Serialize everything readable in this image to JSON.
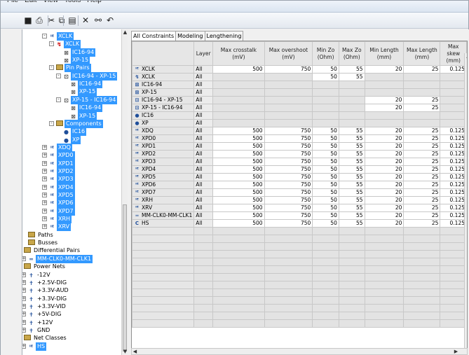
{
  "menu": [
    "File",
    "Edit",
    "View",
    "Tools",
    "Help"
  ],
  "toolbar": {
    "buttons": [
      {
        "name": "save-icon",
        "glyph": "■"
      },
      {
        "name": "print-icon",
        "glyph": "⎙"
      },
      {
        "name": "cut-icon",
        "glyph": "✂"
      },
      {
        "name": "copy-icon",
        "glyph": "⧉"
      },
      {
        "name": "paste-icon",
        "glyph": "▤"
      },
      {
        "name": "delete-icon",
        "glyph": "✕"
      },
      {
        "name": "connect-icon",
        "glyph": "⚯"
      },
      {
        "name": "undo-icon",
        "glyph": "↶"
      }
    ]
  },
  "tree": [
    {
      "indent": 0,
      "exp": "-",
      "icon": "net",
      "label": "XCLK",
      "sel": true
    },
    {
      "indent": 1,
      "exp": "-",
      "icon": "xnet",
      "label": "XCLK",
      "sel": true
    },
    {
      "indent": 2,
      "exp": "",
      "icon": "pin",
      "label": "IC16-94",
      "sel": true
    },
    {
      "indent": 2,
      "exp": "",
      "icon": "pin",
      "label": "XP-15",
      "sel": true
    },
    {
      "indent": 1,
      "exp": "-",
      "icon": "folder",
      "label": "Pin Pairs",
      "sel": true
    },
    {
      "indent": 2,
      "exp": "-",
      "icon": "pair",
      "label": "IC16-94 - XP-15",
      "sel": true
    },
    {
      "indent": 3,
      "exp": "",
      "icon": "pin",
      "label": "IC16-94",
      "sel": true
    },
    {
      "indent": 3,
      "exp": "",
      "icon": "pin",
      "label": "XP-15",
      "sel": true
    },
    {
      "indent": 2,
      "exp": "-",
      "icon": "pair",
      "label": "XP-15 - IC16-94",
      "sel": true
    },
    {
      "indent": 3,
      "exp": "",
      "icon": "pin",
      "label": "IC16-94",
      "sel": true
    },
    {
      "indent": 3,
      "exp": "",
      "icon": "pin",
      "label": "XP-15",
      "sel": true
    },
    {
      "indent": 1,
      "exp": "-",
      "icon": "folder",
      "label": "Components",
      "sel": true
    },
    {
      "indent": 2,
      "exp": "",
      "icon": "comp",
      "label": "IC16",
      "sel": true
    },
    {
      "indent": 2,
      "exp": "",
      "icon": "comp",
      "label": "XP",
      "sel": true
    },
    {
      "indent": 0,
      "exp": "+",
      "icon": "net",
      "label": "XDQ",
      "sel": true
    },
    {
      "indent": 0,
      "exp": "+",
      "icon": "net",
      "label": "XPD0",
      "sel": true
    },
    {
      "indent": 0,
      "exp": "+",
      "icon": "net",
      "label": "XPD1",
      "sel": true
    },
    {
      "indent": 0,
      "exp": "+",
      "icon": "net",
      "label": "XPD2",
      "sel": true
    },
    {
      "indent": 0,
      "exp": "+",
      "icon": "net",
      "label": "XPD3",
      "sel": true
    },
    {
      "indent": 0,
      "exp": "+",
      "icon": "net",
      "label": "XPD4",
      "sel": true
    },
    {
      "indent": 0,
      "exp": "+",
      "icon": "net",
      "label": "XPD5",
      "sel": true
    },
    {
      "indent": 0,
      "exp": "+",
      "icon": "net",
      "label": "XPD6",
      "sel": true
    },
    {
      "indent": 0,
      "exp": "+",
      "icon": "net",
      "label": "XPD7",
      "sel": true
    },
    {
      "indent": 0,
      "exp": "+",
      "icon": "net",
      "label": "XRH",
      "sel": true
    },
    {
      "indent": 0,
      "exp": "+",
      "icon": "net",
      "label": "XRV",
      "sel": true
    },
    {
      "indent": -1,
      "exp": "",
      "icon": "folder",
      "label": "Paths",
      "sel": false
    },
    {
      "indent": -1,
      "exp": "",
      "icon": "folder",
      "label": "Busses",
      "sel": false
    },
    {
      "indent": -2,
      "exp": "-",
      "icon": "folder",
      "label": "Differential Pairs",
      "sel": false
    },
    {
      "indent": -1,
      "exp": "+",
      "icon": "diff",
      "label": "MM-CLK0-MM-CLK1",
      "sel": true
    },
    {
      "indent": -2,
      "exp": "-",
      "icon": "folder",
      "label": "Power Nets",
      "sel": false
    },
    {
      "indent": -1,
      "exp": "+",
      "icon": "pow",
      "label": "-12V",
      "sel": false
    },
    {
      "indent": -1,
      "exp": "+",
      "icon": "pow",
      "label": "+2.5V-DIG",
      "sel": false
    },
    {
      "indent": -1,
      "exp": "+",
      "icon": "pow",
      "label": "+3.3V-AUD",
      "sel": false
    },
    {
      "indent": -1,
      "exp": "+",
      "icon": "pow",
      "label": "+3.3V-DIG",
      "sel": false
    },
    {
      "indent": -1,
      "exp": "+",
      "icon": "pow",
      "label": "+3.3V-VID",
      "sel": false
    },
    {
      "indent": -1,
      "exp": "+",
      "icon": "pow",
      "label": "+5V-DIG",
      "sel": false
    },
    {
      "indent": -1,
      "exp": "+",
      "icon": "pow",
      "label": "+12V",
      "sel": false
    },
    {
      "indent": -1,
      "exp": "+",
      "icon": "pow",
      "label": "GND",
      "sel": false
    },
    {
      "indent": -2,
      "exp": "-",
      "icon": "folder",
      "label": "Net Classes",
      "sel": false
    },
    {
      "indent": -1,
      "exp": "+",
      "icon": "net",
      "label": "HS",
      "sel": true
    }
  ],
  "tabs": [
    "All Constraints",
    "Modeling",
    "Lengthening"
  ],
  "grid": {
    "headers": [
      "",
      "Layer",
      "Max crosstalk (mV)",
      "Max overshoot (mV)",
      "Min Zo (Ohm)",
      "Max Zo (Ohm)",
      "Min Length (mm)",
      "Max Length (mm)",
      "Max skew (mm)"
    ],
    "rows": [
      {
        "icon": "net",
        "name": "XCLK",
        "layer": "All",
        "v": [
          "500",
          "750",
          "50",
          "55",
          "20",
          "25",
          "0.125"
        ]
      },
      {
        "icon": "xnet",
        "name": "XCLK",
        "layer": "All",
        "v": [
          "",
          "",
          "50",
          "55",
          "",
          "",
          ""
        ]
      },
      {
        "icon": "pin",
        "name": "IC16-94",
        "layer": "All",
        "v": [
          "",
          "",
          "",
          "",
          "",
          "",
          ""
        ]
      },
      {
        "icon": "pin",
        "name": "XP-15",
        "layer": "All",
        "v": [
          "",
          "",
          "",
          "",
          "",
          "",
          ""
        ]
      },
      {
        "icon": "pair",
        "name": "IC16-94 - XP-15",
        "layer": "All",
        "v": [
          "",
          "",
          "",
          "",
          "20",
          "25",
          ""
        ]
      },
      {
        "icon": "pair",
        "name": "XP-15 - IC16-94",
        "layer": "All",
        "v": [
          "",
          "",
          "",
          "",
          "20",
          "25",
          ""
        ]
      },
      {
        "icon": "comp",
        "name": "IC16",
        "layer": "All",
        "v": [
          "",
          "",
          "",
          "",
          "",
          "",
          ""
        ]
      },
      {
        "icon": "comp",
        "name": "XP",
        "layer": "All",
        "v": [
          "",
          "",
          "",
          "",
          "",
          "",
          ""
        ]
      },
      {
        "icon": "net",
        "name": "XDQ",
        "layer": "All",
        "v": [
          "500",
          "750",
          "50",
          "55",
          "20",
          "25",
          "0.125"
        ]
      },
      {
        "icon": "net",
        "name": "XPD0",
        "layer": "All",
        "v": [
          "500",
          "750",
          "50",
          "55",
          "20",
          "25",
          "0.125"
        ]
      },
      {
        "icon": "net",
        "name": "XPD1",
        "layer": "All",
        "v": [
          "500",
          "750",
          "50",
          "55",
          "20",
          "25",
          "0.125"
        ]
      },
      {
        "icon": "net",
        "name": "XPD2",
        "layer": "All",
        "v": [
          "500",
          "750",
          "50",
          "55",
          "20",
          "25",
          "0.125"
        ]
      },
      {
        "icon": "net",
        "name": "XPD3",
        "layer": "All",
        "v": [
          "500",
          "750",
          "50",
          "55",
          "20",
          "25",
          "0.125"
        ]
      },
      {
        "icon": "net",
        "name": "XPD4",
        "layer": "All",
        "v": [
          "500",
          "750",
          "50",
          "55",
          "20",
          "25",
          "0.125"
        ]
      },
      {
        "icon": "net",
        "name": "XPD5",
        "layer": "All",
        "v": [
          "500",
          "750",
          "50",
          "55",
          "20",
          "25",
          "0.125"
        ]
      },
      {
        "icon": "net",
        "name": "XPD6",
        "layer": "All",
        "v": [
          "500",
          "750",
          "50",
          "55",
          "20",
          "25",
          "0.125"
        ]
      },
      {
        "icon": "net",
        "name": "XPD7",
        "layer": "All",
        "v": [
          "500",
          "750",
          "50",
          "55",
          "20",
          "25",
          "0.125"
        ]
      },
      {
        "icon": "net",
        "name": "XRH",
        "layer": "All",
        "v": [
          "500",
          "750",
          "50",
          "55",
          "20",
          "25",
          "0.125"
        ]
      },
      {
        "icon": "net",
        "name": "XRV",
        "layer": "All",
        "v": [
          "500",
          "750",
          "50",
          "55",
          "20",
          "25",
          "0.125"
        ]
      },
      {
        "icon": "diff",
        "name": "MM-CLK0-MM-CLK1",
        "layer": "All",
        "v": [
          "500",
          "750",
          "50",
          "55",
          "20",
          "25",
          "0.125"
        ]
      },
      {
        "icon": "class",
        "name": "HS",
        "layer": "All",
        "v": [
          "500",
          "750",
          "50",
          "55",
          "20",
          "25",
          "0.125"
        ]
      }
    ],
    "empty_rows": 13
  }
}
